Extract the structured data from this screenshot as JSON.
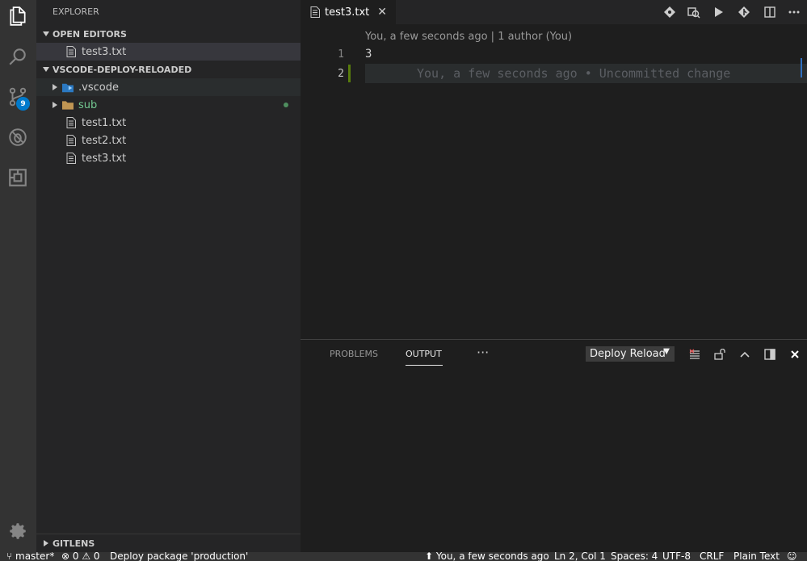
{
  "activity_bar": {
    "icons": [
      "files-icon",
      "search-icon",
      "source-control-icon",
      "debug-icon",
      "extensions-icon",
      "settings-gear-icon"
    ],
    "scm_badge": "9"
  },
  "sidebar": {
    "title": "EXPLORER",
    "open_editors": {
      "header": "OPEN EDITORS",
      "files": [
        "test3.txt"
      ]
    },
    "project": {
      "header": "VSCODE-DEPLOY-RELOADED",
      "items": [
        {
          "label": ".vscode",
          "type": "folder"
        },
        {
          "label": "sub",
          "type": "folder"
        },
        {
          "label": "test1.txt",
          "type": "file"
        },
        {
          "label": "test2.txt",
          "type": "file"
        },
        {
          "label": "test3.txt",
          "type": "file"
        }
      ]
    },
    "gitlens_header": "GITLENS"
  },
  "editor": {
    "tab_label": "test3.txt",
    "code_lens": "You, a few seconds ago | 1 author (You)",
    "lines": [
      {
        "number": "1",
        "text": "3"
      },
      {
        "number": "2",
        "text": ""
      }
    ],
    "blame_annotation": "You, a few seconds ago • Uncommitted change"
  },
  "panel": {
    "tabs": [
      "PROBLEMS",
      "OUTPUT"
    ],
    "active_tab": "OUTPUT",
    "more": "···",
    "output_channel": "Deploy Reload"
  },
  "statusbar": {
    "branch": "master*",
    "errors": "0",
    "warnings": "0",
    "message": "Deploy package 'production'",
    "blame": "You, a few seconds ago",
    "position": "Ln 2, Col 1",
    "spaces": "Spaces: 4",
    "encoding": "UTF-8",
    "eol": "CRLF",
    "language": "Plain Text"
  },
  "colors": {
    "activity_bar": "#333333",
    "sidebar": "#252526",
    "editor": "#1e1e1e",
    "accent": "#007acc",
    "folder_green": "#73c991",
    "git_added": "#587c0c"
  }
}
